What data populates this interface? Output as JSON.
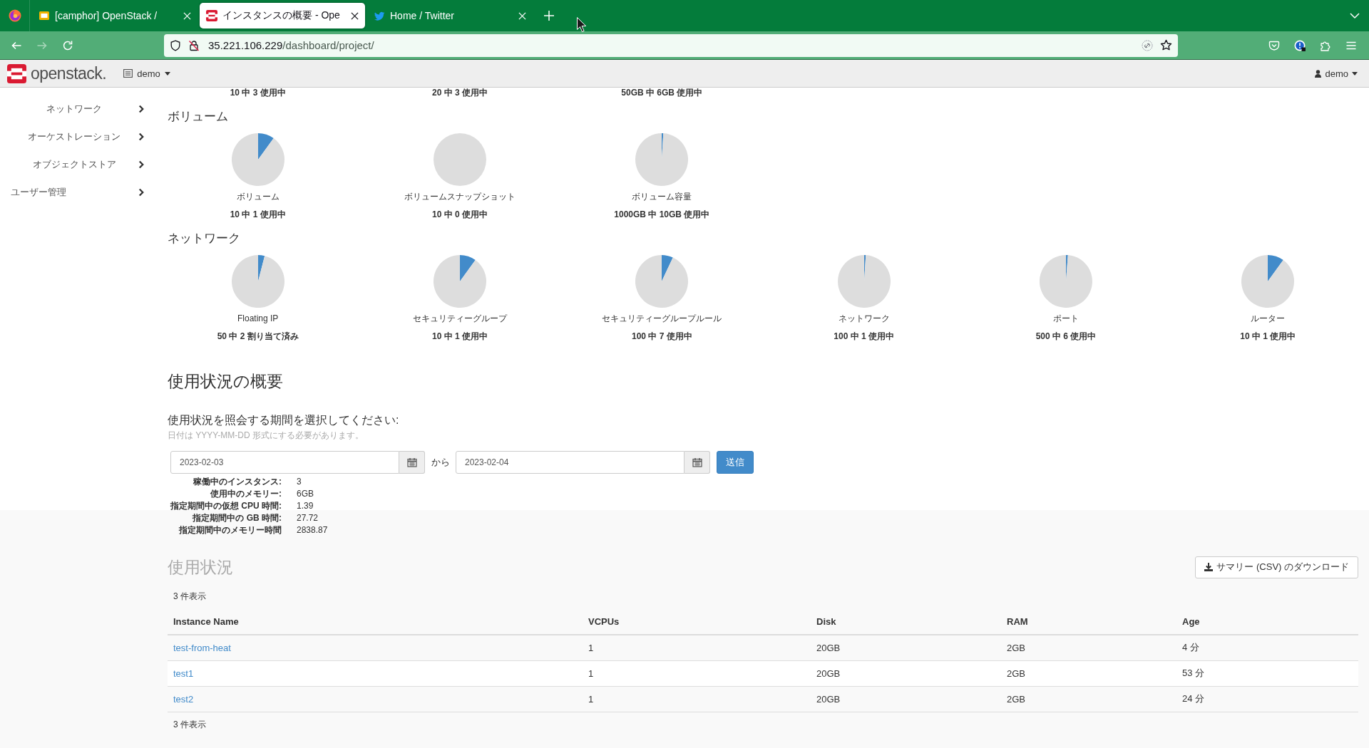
{
  "browser": {
    "tabs": [
      {
        "title": "[camphor] OpenStack /",
        "kind": "document",
        "selected": false
      },
      {
        "title": "インスタンスの概要 - Ope",
        "kind": "dashboard",
        "selected": true
      },
      {
        "title": "Home / Twitter",
        "kind": "social",
        "selected": false
      }
    ],
    "address": {
      "host": "35.221.106.229",
      "path": "/dashboard/project/"
    }
  },
  "header": {
    "logo": "openstack.",
    "project_menu": "demo",
    "user_menu": "demo"
  },
  "sidebar": {
    "items": [
      {
        "label": "ネットワーク",
        "kind": "group"
      },
      {
        "label": "オーケストレーション",
        "kind": "group"
      },
      {
        "label": "オブジェクトストア",
        "kind": "group"
      },
      {
        "label": "ユーザー管理",
        "kind": "dashboard"
      }
    ]
  },
  "limits": {
    "partial_row": [
      {
        "usage": "10 中 3 使用中"
      },
      {
        "usage": "20 中 3 使用中"
      },
      {
        "usage": "50GB 中 6GB 使用中"
      }
    ],
    "sections": [
      {
        "title": "ボリューム",
        "charts": [
          {
            "label": "ボリューム",
            "usage": "10 中 1 使用中",
            "chart_data": {
              "type": "pie",
              "values": [
                10,
                90
              ]
            }
          },
          {
            "label": "ボリュームスナップショット",
            "usage": "10 中 0 使用中",
            "chart_data": {
              "type": "pie",
              "values": [
                0,
                100
              ]
            }
          },
          {
            "label": "ボリューム容量",
            "usage": "1000GB 中 10GB 使用中",
            "chart_data": {
              "type": "pie",
              "values": [
                1,
                99
              ]
            }
          }
        ]
      },
      {
        "title": "ネットワーク",
        "charts": [
          {
            "label": "Floating IP",
            "usage": "50 中 2 割り当て済み",
            "chart_data": {
              "type": "pie",
              "values": [
                4,
                96
              ]
            }
          },
          {
            "label": "セキュリティーグループ",
            "usage": "10 中 1 使用中",
            "chart_data": {
              "type": "pie",
              "values": [
                10,
                90
              ]
            }
          },
          {
            "label": "セキュリティーグループルール",
            "usage": "100 中 7 使用中",
            "chart_data": {
              "type": "pie",
              "values": [
                7,
                93
              ]
            }
          },
          {
            "label": "ネットワーク",
            "usage": "100 中 1 使用中",
            "chart_data": {
              "type": "pie",
              "values": [
                1,
                99
              ]
            }
          },
          {
            "label": "ポート",
            "usage": "500 中 6 使用中",
            "chart_data": {
              "type": "pie",
              "values": [
                1.2,
                98.8
              ]
            }
          },
          {
            "label": "ルーター",
            "usage": "10 中 1 使用中",
            "chart_data": {
              "type": "pie",
              "values": [
                10,
                90
              ]
            }
          }
        ]
      }
    ]
  },
  "usage_summary": {
    "title": "使用状況の概要",
    "form_title": "使用状況を照会する期間を選択してください:",
    "hint": "日付は YYYY-MM-DD 形式にする必要があります。",
    "start_date": "2023-02-03",
    "separator": "から",
    "end_date": "2023-02-04",
    "submit": "送信",
    "stats": [
      {
        "label": "稼働中のインスタンス:",
        "value": "3"
      },
      {
        "label": "使用中のメモリー:",
        "value": "6GB"
      },
      {
        "label": "指定期間中の仮想 CPU 時間:",
        "value": "1.39"
      },
      {
        "label": "指定期間中の GB 時間:",
        "value": "27.72"
      },
      {
        "label": "指定期間中のメモリー時間",
        "value": "2838.87"
      }
    ]
  },
  "usage": {
    "title": "使用状況",
    "download": "サマリー (CSV) のダウンロード",
    "count_top": "3 件表示",
    "table": {
      "columns": [
        "Instance Name",
        "VCPUs",
        "Disk",
        "RAM",
        "Age"
      ],
      "rows": [
        [
          "test-from-heat",
          "1",
          "20GB",
          "2GB",
          "4 分"
        ],
        [
          "test1",
          "1",
          "20GB",
          "2GB",
          "53 分"
        ],
        [
          "test2",
          "1",
          "20GB",
          "2GB",
          "24 分"
        ]
      ]
    },
    "count_bottom": "3 件表示"
  }
}
